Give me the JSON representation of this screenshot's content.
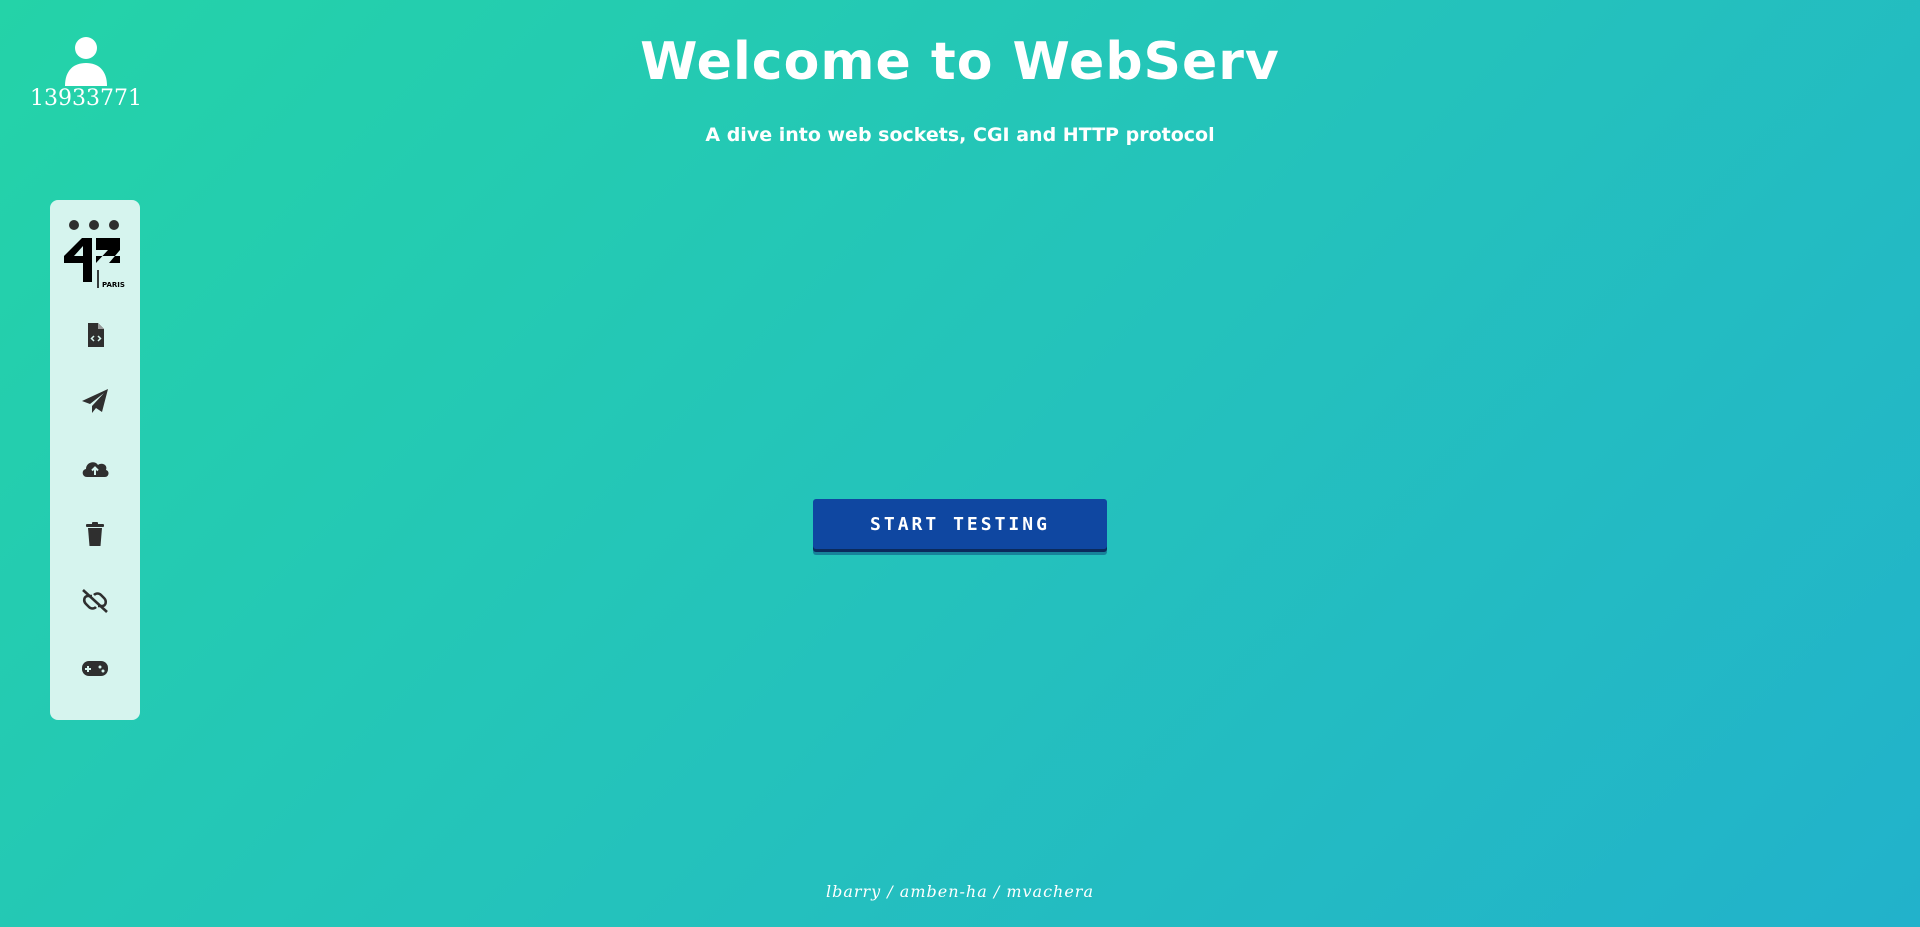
{
  "user": {
    "icon": "user-icon",
    "id": "13933771"
  },
  "header": {
    "title": "Welcome to WebServ",
    "subtitle": "A dive into web sockets, CGI and HTTP protocol"
  },
  "sidebar": {
    "logo_text": "PARIS",
    "items": [
      {
        "icon": "file-code-icon"
      },
      {
        "icon": "paper-plane-icon"
      },
      {
        "icon": "cloud-upload-icon"
      },
      {
        "icon": "trash-icon"
      },
      {
        "icon": "broken-link-icon"
      },
      {
        "icon": "gamepad-icon"
      }
    ]
  },
  "main": {
    "start_button_label": "START TESTING"
  },
  "footer": {
    "credits": "lbarry / amben-ha / mvachera"
  },
  "colors": {
    "background_start": "#24d3a8",
    "background_end": "#22b2cb",
    "sidebar": "#d6f4ee",
    "button": "#0f47a1",
    "icon": "#2f2f2f"
  }
}
